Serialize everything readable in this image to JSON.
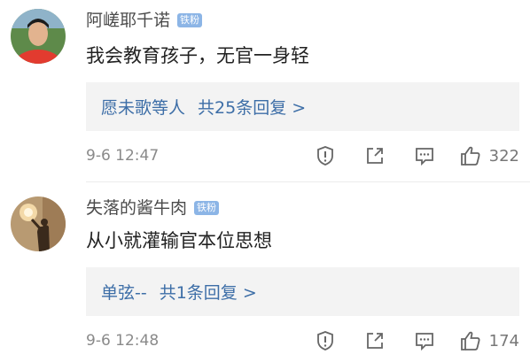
{
  "comments": [
    {
      "username": "阿嵯耶千诺",
      "badge": "铁粉",
      "text": "我会教育孩子，无官一身轻",
      "replies": {
        "who": "愿未歌等人",
        "count": "共25条回复 >"
      },
      "time": "9-6 12:47",
      "likes": "322",
      "avatar_icon": "person-red-shirt-avatar"
    },
    {
      "username": "失落的酱牛肉",
      "badge": "铁粉",
      "text": "从小就灌输官本位思想",
      "replies": {
        "who": "单弦--",
        "count": "共1条回复 >"
      },
      "time": "9-6 12:48",
      "likes": "174",
      "avatar_icon": "silhouette-lamp-avatar"
    }
  ],
  "icons": [
    "report-icon",
    "share-icon",
    "comment-icon",
    "thumbs-up-icon"
  ],
  "colors": {
    "badge": "#8cb5e6",
    "link": "#3d6ea7",
    "reply_bg": "#f3f3f3",
    "meta": "#8a8a8a"
  }
}
